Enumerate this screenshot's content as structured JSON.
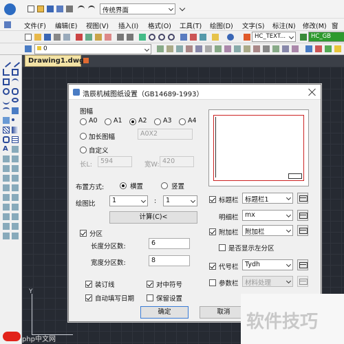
{
  "app": {
    "workspace": "传统界面",
    "menu": [
      "文件(F)",
      "编辑(E)",
      "视图(V)",
      "插入(I)",
      "格式(O)",
      "工具(T)",
      "绘图(D)",
      "文字(S)",
      "标注(N)",
      "修改(M)",
      "窗口"
    ],
    "textstyle": "HC_TEXT...",
    "textstyle2": "HC_GB",
    "layer": "0",
    "tab": "Drawing1.dwg"
  },
  "dialog": {
    "title": "浩辰机械图纸设置（GB14689-1993）",
    "paper_group": "图幅",
    "sizes": [
      "A0",
      "A1",
      "A2",
      "A3",
      "A4"
    ],
    "extend_label": "加长图幅",
    "extend_value": "A0X2",
    "custom_label": "自定义",
    "length_label": "长L:",
    "length_value": "594",
    "width_label": "宽W:",
    "width_value": "420",
    "layout_label": "布置方式:",
    "layout_landscape": "横置",
    "layout_portrait": "竖置",
    "scale_label": "绘图比",
    "scale_left": "1",
    "scale_colon": ":",
    "scale_right": "1",
    "calc_button": "计算(C)<",
    "zone_label": "分区",
    "zone_len_label": "长度分区数:",
    "zone_len_value": "6",
    "zone_wid_label": "宽度分区数:",
    "zone_wid_value": "8",
    "binding_label": "装订线",
    "center_label": "对中符号",
    "autofill_label": "自动填写日期",
    "keep_label": "保留设置",
    "title_block_label": "标题栏",
    "title_block_value": "标题栏1",
    "detail_label": "明细栏",
    "detail_value": "mx",
    "extra_label": "附加栏",
    "extra_value": "附加栏",
    "show_zone_label": "是否显示左分区",
    "code_label": "代号栏",
    "code_value": "Tydh",
    "param_label": "参数栏",
    "param_value": "材料处理",
    "ok_button": "确定",
    "cancel_button": "取消"
  },
  "watermark": {
    "text": "软件技巧",
    "site": "php中文网"
  }
}
